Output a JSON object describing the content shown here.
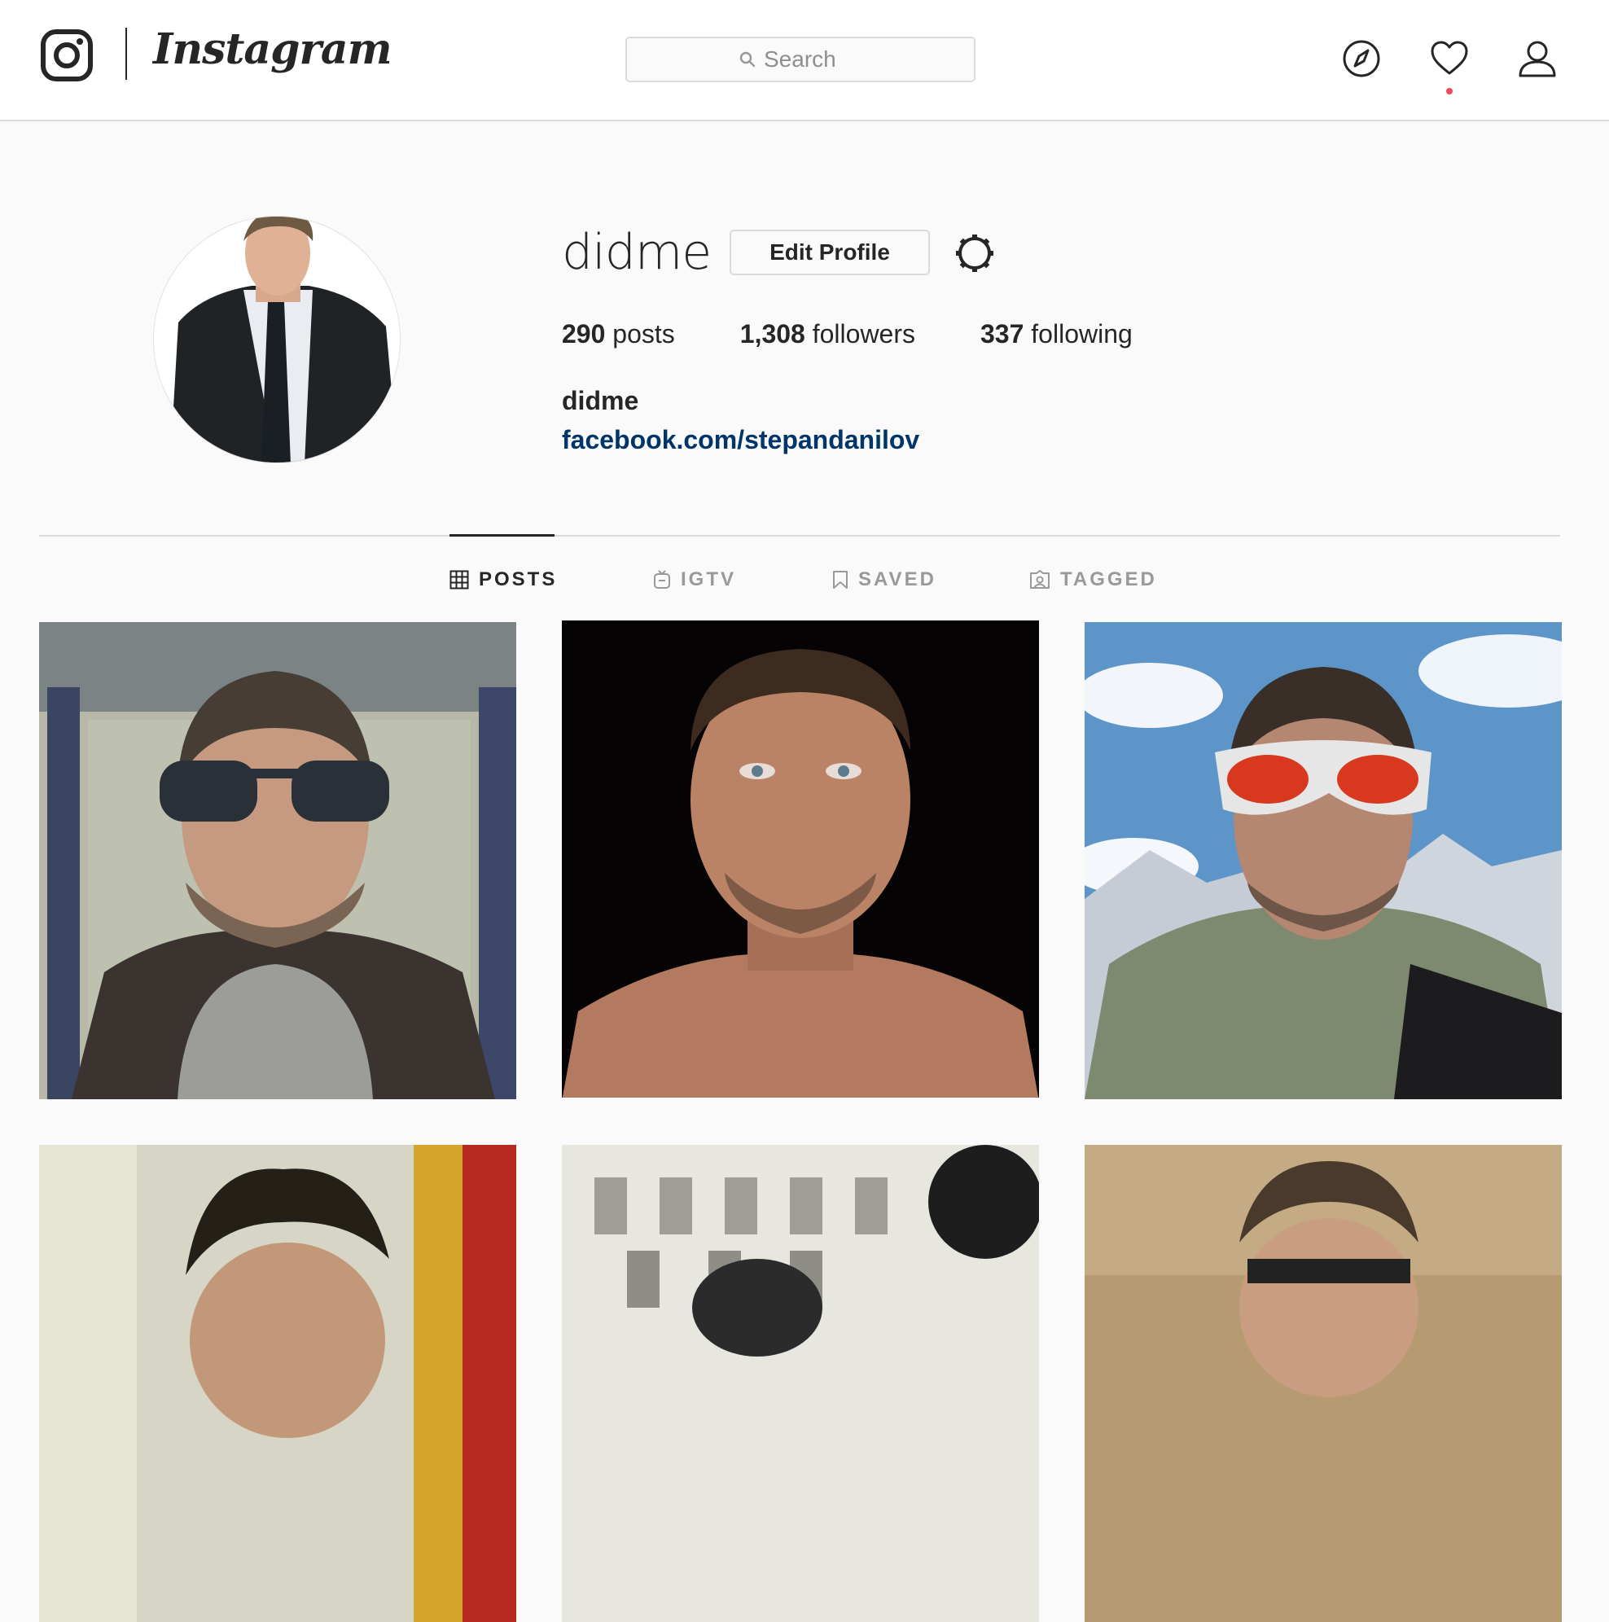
{
  "header": {
    "brand": "Instagram",
    "search": {
      "placeholder": "Search"
    },
    "nav_icons": [
      "compass-icon",
      "heart-icon",
      "profile-icon"
    ],
    "has_activity_notification": true
  },
  "profile": {
    "username": "didme",
    "edit_label": "Edit Profile",
    "stats": [
      {
        "count": "290",
        "label": "posts"
      },
      {
        "count": "1,308",
        "label": "followers"
      },
      {
        "count": "337",
        "label": "following"
      }
    ],
    "full_name": "didme",
    "link": "facebook.com/stepandanilov"
  },
  "tabs": [
    {
      "label": "POSTS",
      "icon": "grid-icon",
      "active": true
    },
    {
      "label": "IGTV",
      "icon": "igtv-icon",
      "active": false
    },
    {
      "label": "SAVED",
      "icon": "bookmark-icon",
      "active": false
    },
    {
      "label": "TAGGED",
      "icon": "tagged-icon",
      "active": false
    }
  ],
  "colors": {
    "link": "#003569",
    "notification": "#ed4956",
    "text": "#262626",
    "muted": "#999999",
    "border": "#dbdbdb"
  }
}
